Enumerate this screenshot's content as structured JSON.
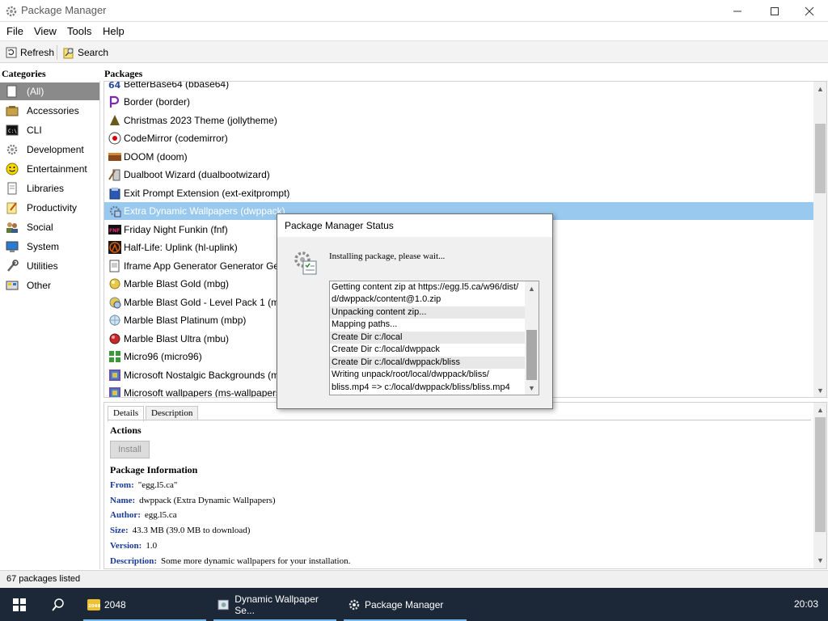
{
  "window": {
    "title": "Package Manager",
    "min_icon": "minimize-icon",
    "max_icon": "maximize-icon",
    "close_icon": "close-icon"
  },
  "menu": [
    "File",
    "View",
    "Tools",
    "Help"
  ],
  "toolbar": {
    "refresh": "Refresh",
    "search": "Search"
  },
  "categories": {
    "header": "Categories",
    "items": [
      {
        "label": "(All)",
        "icon": "all-icon",
        "selected": true
      },
      {
        "label": "Accessories",
        "icon": "accessories-icon"
      },
      {
        "label": "CLI",
        "icon": "cli-icon"
      },
      {
        "label": "Development",
        "icon": "development-icon"
      },
      {
        "label": "Entertainment",
        "icon": "entertainment-icon"
      },
      {
        "label": "Libraries",
        "icon": "libraries-icon"
      },
      {
        "label": "Productivity",
        "icon": "productivity-icon"
      },
      {
        "label": "Social",
        "icon": "social-icon"
      },
      {
        "label": "System",
        "icon": "system-icon"
      },
      {
        "label": "Utilities",
        "icon": "utilities-icon"
      },
      {
        "label": "Other",
        "icon": "other-icon"
      }
    ]
  },
  "packages": {
    "header": "Packages",
    "items": [
      {
        "label": "BetterBase64 (bbase64)",
        "icon": "base64-icon"
      },
      {
        "label": "Border (border)",
        "icon": "border-icon"
      },
      {
        "label": "Christmas 2023 Theme (jollytheme)",
        "icon": "tree-icon"
      },
      {
        "label": "CodeMirror (codemirror)",
        "icon": "codemirror-icon"
      },
      {
        "label": "DOOM (doom)",
        "icon": "doom-icon"
      },
      {
        "label": "Dualboot Wizard (dualbootwizard)",
        "icon": "wizard-icon"
      },
      {
        "label": "Exit Prompt Extension (ext-exitprompt)",
        "icon": "extension-icon"
      },
      {
        "label": "Extra Dynamic Wallpapers (dwppack)",
        "icon": "wallpaper-icon",
        "selected": true
      },
      {
        "label": "Friday Night Funkin (fnf)",
        "icon": "fnf-icon"
      },
      {
        "label": "Half-Life: Uplink (hl-uplink)",
        "icon": "halflife-icon"
      },
      {
        "label": "Iframe App Generator Generator Generator",
        "icon": "iframe-icon"
      },
      {
        "label": "Marble Blast Gold (mbg)",
        "icon": "marble-gold-icon"
      },
      {
        "label": "Marble Blast Gold - Level Pack 1 (mbglp1)",
        "icon": "marble-pack-icon"
      },
      {
        "label": "Marble Blast Platinum (mbp)",
        "icon": "marble-platinum-icon"
      },
      {
        "label": "Marble Blast Ultra (mbu)",
        "icon": "marble-ultra-icon"
      },
      {
        "label": "Micro96 (micro96)",
        "icon": "micro96-icon"
      },
      {
        "label": "Microsoft Nostalgic Backgrounds (ms-nos",
        "icon": "backgrounds-icon"
      },
      {
        "label": "Microsoft wallpapers (ms-wallpapers)",
        "icon": "ms-wallpapers-icon"
      }
    ]
  },
  "details": {
    "tabs": [
      "Details",
      "Description"
    ],
    "actions_header": "Actions",
    "install_label": "Install",
    "info_header": "Package Information",
    "fields": [
      {
        "key": "From:",
        "value": "\"egg.l5.ca\""
      },
      {
        "key": "Name:",
        "value": "dwppack (Extra Dynamic Wallpapers)"
      },
      {
        "key": "Author:",
        "value": "egg.l5.ca"
      },
      {
        "key": "Size:",
        "value": "43.3 MB (39.0 MB to download)"
      },
      {
        "key": "Version:",
        "value": "1.0"
      },
      {
        "key": "Description:",
        "value": "Some more dynamic wallpapers for your installation."
      }
    ]
  },
  "status": {
    "text": "67 packages listed"
  },
  "dialog": {
    "title": "Package Manager Status",
    "message": "Installing package, please wait...",
    "log": [
      {
        "text": "Getting content zip at https://egg.l5.ca/w96/dist/",
        "hl": false
      },
      {
        "text": "d/dwppack/content@1.0.zip",
        "hl": false
      },
      {
        "text": "Unpacking content zip...",
        "hl": true
      },
      {
        "text": "Mapping paths...",
        "hl": false
      },
      {
        "text": "Create Dir c:/local",
        "hl": true
      },
      {
        "text": "Create Dir c:/local/dwppack",
        "hl": false
      },
      {
        "text": "Create Dir c:/local/dwppack/bliss",
        "hl": true
      },
      {
        "text": "Writing unpack/root/local/dwppack/bliss/",
        "hl": false
      },
      {
        "text": "bliss.mp4 => c:/local/dwppack/bliss/bliss.mp4",
        "hl": false
      }
    ]
  },
  "taskbar": {
    "tasks": [
      {
        "label": "2048",
        "icon": "game-2048-icon"
      },
      {
        "label": "Dynamic Wallpaper Se...",
        "icon": "dynamic-wallpaper-icon"
      },
      {
        "label": "Package Manager",
        "icon": "package-manager-icon"
      }
    ],
    "clock": "20:03"
  }
}
